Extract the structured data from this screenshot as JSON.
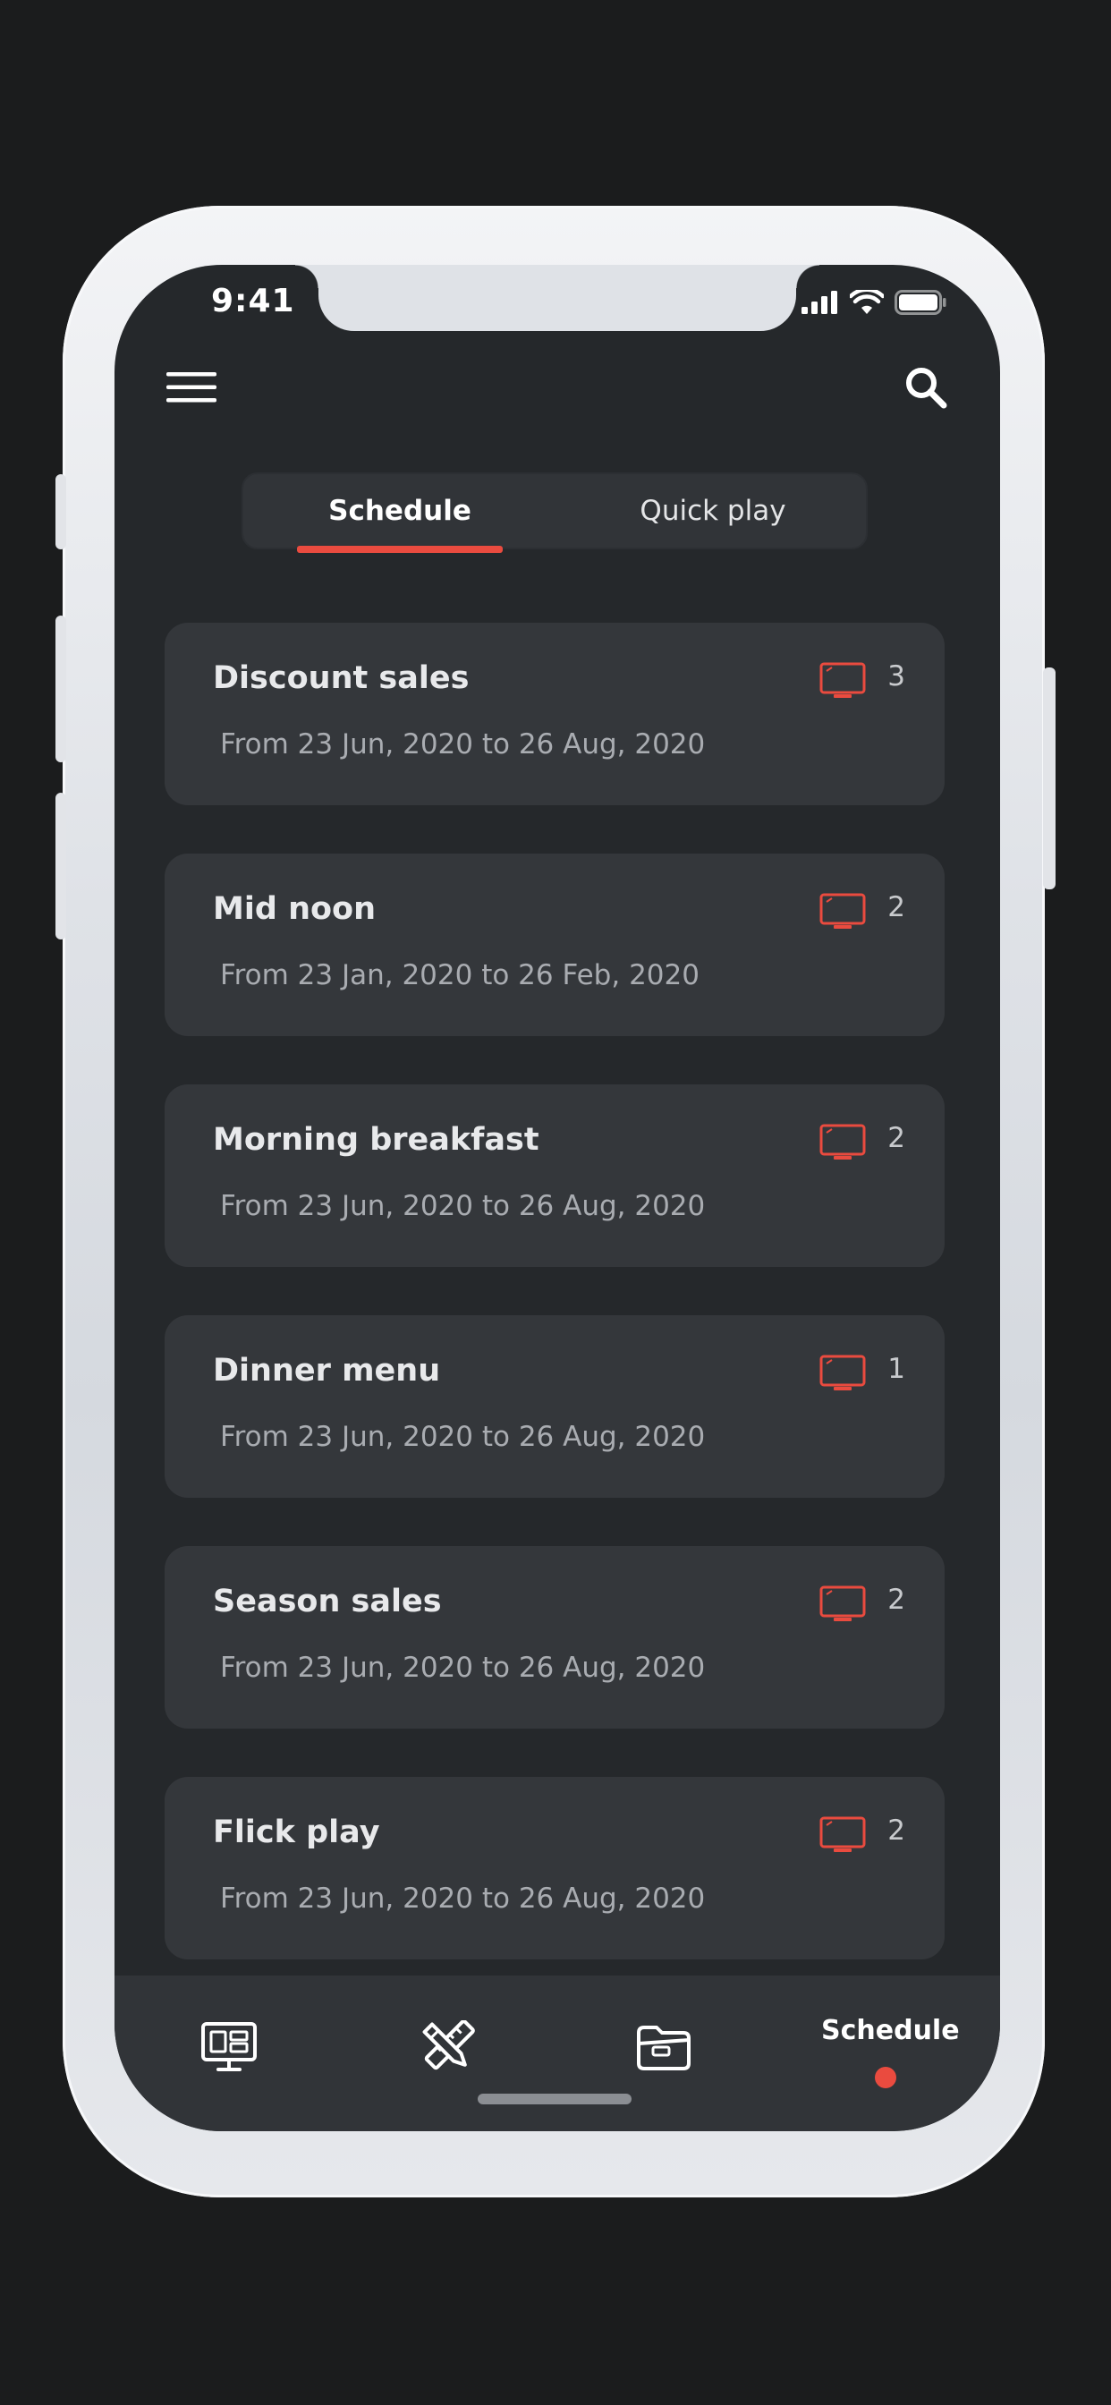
{
  "status_bar": {
    "time": "9:41"
  },
  "tabs": [
    {
      "label": "Schedule",
      "active": true
    },
    {
      "label": "Quick play",
      "active": false
    }
  ],
  "schedules": [
    {
      "title": "Discount sales",
      "dates": "From 23 Jun, 2020 to 26 Aug, 2020",
      "count": "3"
    },
    {
      "title": "Mid noon",
      "dates": "From 23 Jan, 2020 to 26 Feb, 2020",
      "count": "2"
    },
    {
      "title": "Morning breakfast",
      "dates": "From 23 Jun, 2020 to 26 Aug, 2020",
      "count": "2"
    },
    {
      "title": "Dinner menu",
      "dates": "From 23 Jun, 2020 to 26 Aug, 2020",
      "count": "1"
    },
    {
      "title": "Season sales",
      "dates": "From 23 Jun, 2020 to 26 Aug, 2020",
      "count": "2"
    },
    {
      "title": "Flick play",
      "dates": "From 23 Jun, 2020 to 26 Aug, 2020",
      "count": "2"
    }
  ],
  "bottom_nav": {
    "items": [
      {
        "icon": "display-dashboard-icon"
      },
      {
        "icon": "pencil-ruler-icon"
      },
      {
        "icon": "folder-icon"
      },
      {
        "label": "Schedule",
        "active": true
      }
    ]
  },
  "colors": {
    "accent": "#ea4b3f",
    "screen_bg": "#25282b",
    "card_bg": "#34373b"
  }
}
